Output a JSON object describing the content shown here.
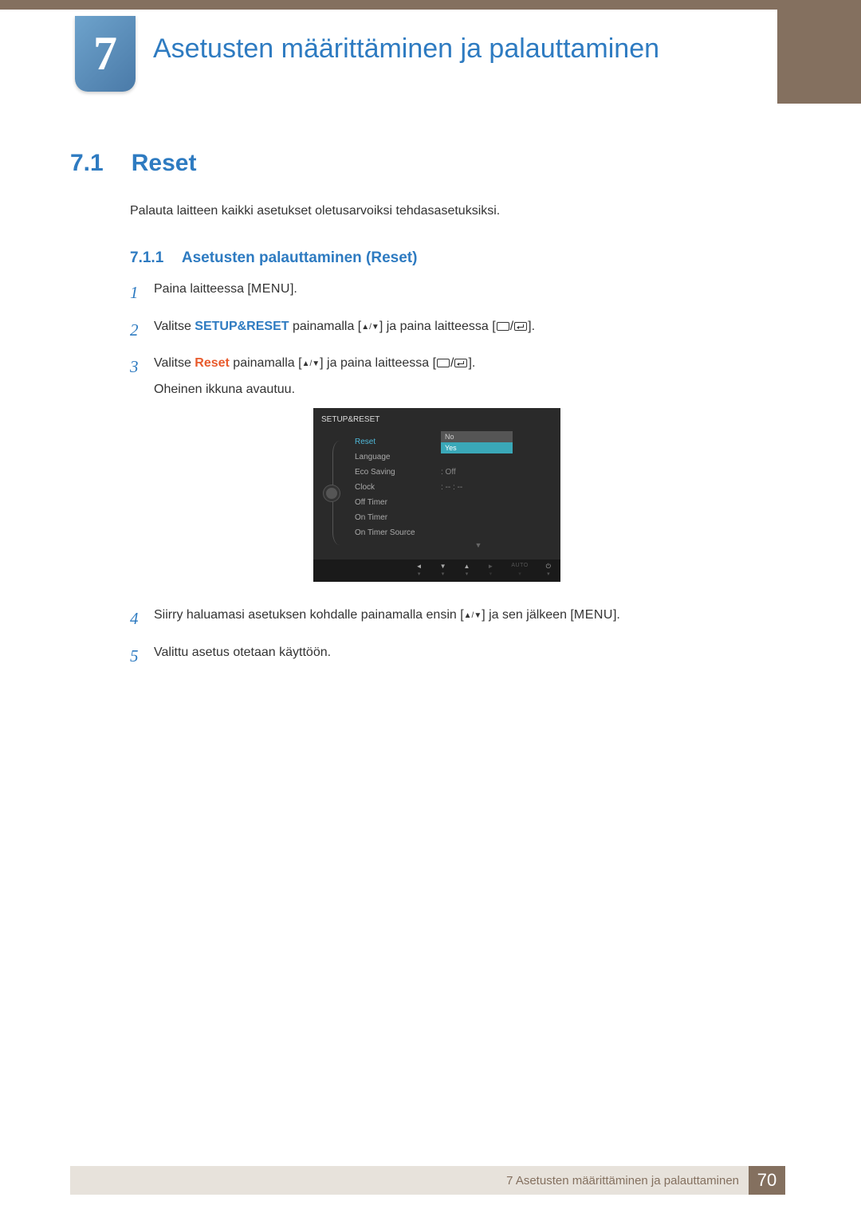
{
  "chapter": {
    "number": "7",
    "title": "Asetusten määrittäminen ja palauttaminen"
  },
  "section": {
    "number": "7.1",
    "title": "Reset"
  },
  "intro": "Palauta laitteen kaikki asetukset oletusarvoiksi tehdasasetuksiksi.",
  "subsection": {
    "number": "7.1.1",
    "title": "Asetusten palauttaminen (Reset)"
  },
  "steps": {
    "s1": {
      "num": "1",
      "a": "Paina laitteessa [",
      "menu": "MENU",
      "b": "]."
    },
    "s2": {
      "num": "2",
      "a": "Valitse ",
      "kw": "SETUP&RESET",
      "b": " painamalla [",
      "c": "] ja paina laitteessa [",
      "d": "]."
    },
    "s3": {
      "num": "3",
      "a": "Valitse ",
      "kw": "Reset",
      "b": " painamalla [",
      "c": "] ja paina laitteessa [",
      "d": "].",
      "e": "Oheinen ikkuna avautuu."
    },
    "s4": {
      "num": "4",
      "a": "Siirry haluamasi asetuksen kohdalle painamalla ensin [",
      "b": "] ja sen jälkeen [",
      "menu": "MENU",
      "c": "]."
    },
    "s5": {
      "num": "5",
      "a": "Valittu asetus otetaan käyttöön."
    }
  },
  "arrows": {
    "updown": "▲/▼",
    "slash": "/"
  },
  "osd": {
    "header": "SETUP&RESET",
    "rows": {
      "reset": "Reset",
      "language": "Language",
      "eco": "Eco Saving",
      "clock": "Clock",
      "offtimer": "Off Timer",
      "ontimer": "On Timer",
      "ontimersrc": "On Timer Source"
    },
    "vals": {
      "eco": ": Off",
      "clock": ":   -- : --"
    },
    "dropdown": {
      "no": "No",
      "yes": "Yes"
    },
    "downarrow": "▼",
    "footer": {
      "auto": "AUTO",
      "blank": " "
    }
  },
  "footer": {
    "text": "7 Asetusten määrittäminen ja palauttaminen",
    "page": "70"
  }
}
